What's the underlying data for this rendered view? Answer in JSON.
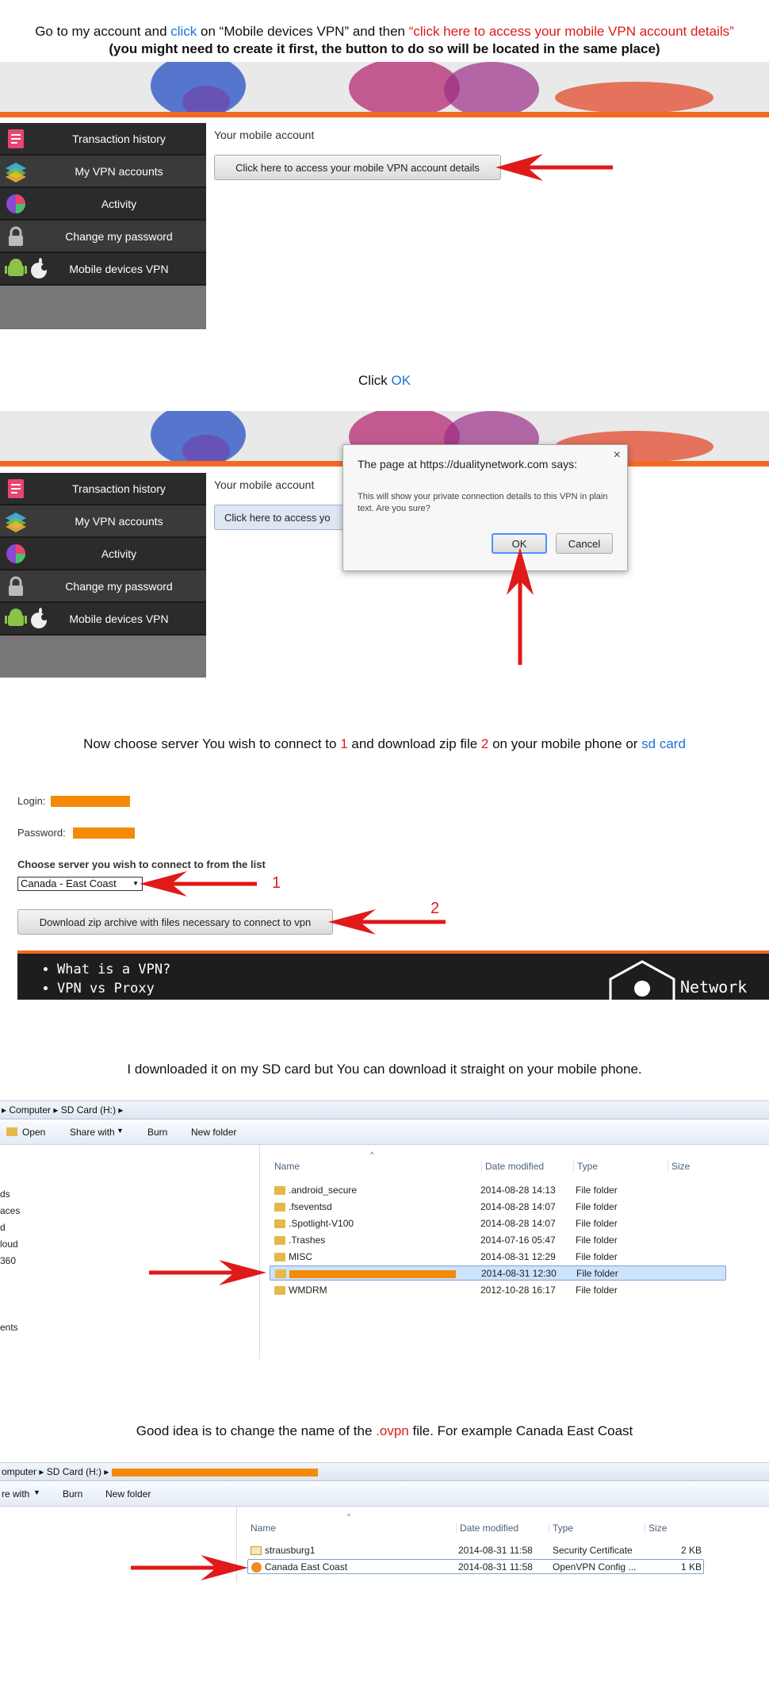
{
  "section1": {
    "caption_line1": {
      "pre": "Go to my account and ",
      "click": "click",
      "mid": " on “Mobile devices VPN” and then ",
      "red": "“click here to access your mobile VPN account details”"
    },
    "caption_line2": "(you might need to create it first, the button to do so will be located in the same place)",
    "sidebar_items": [
      {
        "label": "Transaction history",
        "icon": "document-icon"
      },
      {
        "label": "My VPN accounts",
        "icon": "layers-icon"
      },
      {
        "label": "Activity",
        "icon": "pie-chart-icon"
      },
      {
        "label": "Change my password",
        "icon": "lock-icon"
      },
      {
        "label": "Mobile devices VPN",
        "icon": "android-apple-icon"
      }
    ],
    "pane_title": "Your mobile account",
    "access_button": "Click here to access your mobile VPN account details"
  },
  "section2": {
    "caption_pre": "Click ",
    "caption_ok": "OK",
    "pane_title": "Your mobile account",
    "access_button_partial": "Click here to access yo",
    "dialog": {
      "title": "The page at https://dualitynetwork.com says:",
      "message": "This will show your private connection details to this VPN in plain text. Are you sure?",
      "ok": "OK",
      "cancel": "Cancel",
      "close": "×"
    }
  },
  "section3": {
    "caption": {
      "pre": "Now choose server You wish to connect to ",
      "n1": "1",
      "mid": " and download zip file ",
      "n2": "2",
      "post": " on your mobile phone or ",
      "sd": "sd card"
    },
    "login_label": "Login:",
    "password_label": "Password:",
    "choose_label": "Choose server you wish to connect to from the list",
    "server_selected": "Canada - East Coast",
    "download_button": "Download zip archive with files necessary to connect to vpn",
    "marker1": "1",
    "marker2": "2",
    "footer_bullets": [
      "What is a VPN?",
      "VPN vs Proxy"
    ],
    "footer_brand": "Network"
  },
  "section4": {
    "caption": "I downloaded it on my SD card but You can download it straight on your mobile phone.",
    "breadcrumb": [
      "Computer",
      "SD Card (H:)"
    ],
    "toolbar": [
      "Open",
      "Share with",
      "Burn",
      "New folder"
    ],
    "nav_fragments": [
      "ds",
      "aces",
      "d",
      "loud",
      "360",
      "ents"
    ],
    "columns": [
      "Name",
      "Date modified",
      "Type",
      "Size"
    ],
    "rows": [
      {
        "name": ".android_secure",
        "date": "2014-08-28 14:13",
        "type": "File folder"
      },
      {
        "name": ".fseventsd",
        "date": "2014-08-28 14:07",
        "type": "File folder"
      },
      {
        "name": ".Spotlight-V100",
        "date": "2014-08-28 14:07",
        "type": "File folder"
      },
      {
        "name": ".Trashes",
        "date": "2014-07-16 05:47",
        "type": "File folder"
      },
      {
        "name": "MISC",
        "date": "2014-08-31 12:29",
        "type": "File folder"
      },
      {
        "name": "",
        "date": "2014-08-31 12:30",
        "type": "File folder",
        "selected": true
      },
      {
        "name": "WMDRM",
        "date": "2012-10-28 16:17",
        "type": "File folder"
      }
    ]
  },
  "section5": {
    "caption": {
      "pre": "Good idea is to change the name of the ",
      "ext": ".ovpn",
      "post": " file. For example Canada East Coast"
    },
    "breadcrumb": [
      "omputer",
      "SD Card (H:)"
    ],
    "toolbar": [
      "re with",
      "Burn",
      "New folder"
    ],
    "columns": [
      "Name",
      "Date modified",
      "Type",
      "Size"
    ],
    "rows": [
      {
        "name": "strausburg1",
        "date": "2014-08-31 11:58",
        "type": "Security Certificate",
        "size": "2 KB"
      },
      {
        "name": "Canada East Coast",
        "date": "2014-08-31 11:58",
        "type": "OpenVPN Config ...",
        "size": "1 KB"
      }
    ]
  },
  "colors": {
    "accent_orange": "#f26a21",
    "arrow_red": "#e01919",
    "link_blue": "#1a73d8"
  }
}
